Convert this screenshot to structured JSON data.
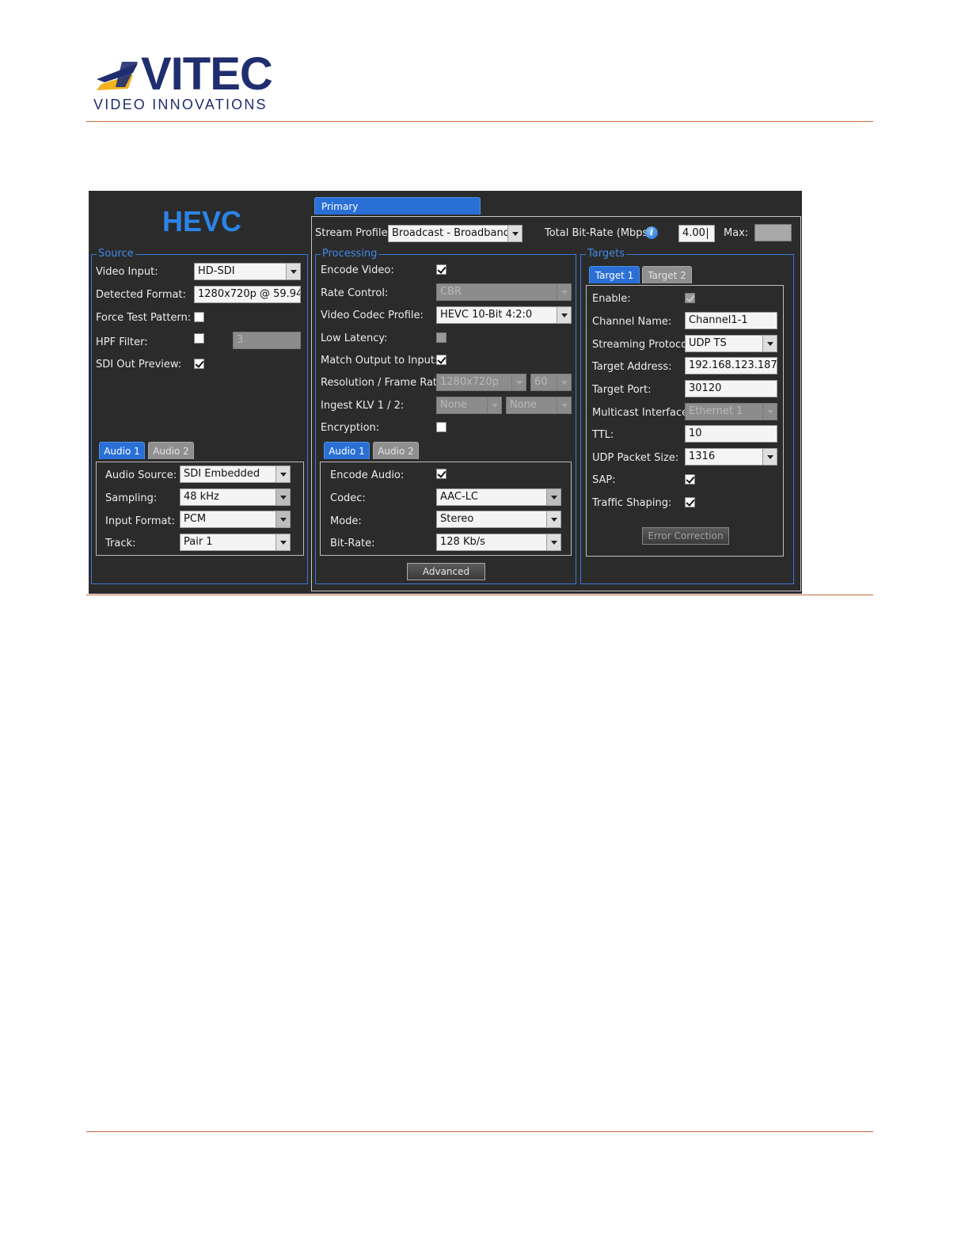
{
  "logo": {
    "brand": "VITEC",
    "tagline": "VIDEO INNOVATIONS",
    "colors": {
      "navy": "#1f2e6e",
      "yellow": "#f0b31e"
    }
  },
  "app": {
    "title_logo": "HEVC",
    "main_tab": "Primary",
    "header": {
      "stream_profile_label": "Stream Profile:",
      "stream_profile_value": "Broadcast - Broadband",
      "total_bitrate_label": "Total Bit-Rate (Mbps)",
      "total_bitrate_value": "4.00",
      "max_label": "Max:",
      "max_value": ""
    },
    "source": {
      "legend": "Source",
      "video_input_label": "Video Input:",
      "video_input_value": "HD-SDI",
      "detected_format_label": "Detected Format:",
      "detected_format_value": "1280x720p @ 59.94",
      "force_test_pattern_label": "Force Test Pattern:",
      "hpf_filter_label": "HPF Filter:",
      "hpf_value": "3",
      "sdi_out_preview_label": "SDI Out Preview:",
      "audio_tabs": [
        "Audio 1",
        "Audio 2"
      ],
      "audio": {
        "source_label": "Audio Source:",
        "source_value": "SDI Embedded",
        "sampling_label": "Sampling:",
        "sampling_value": "48 kHz",
        "input_format_label": "Input Format:",
        "input_format_value": "PCM",
        "track_label": "Track:",
        "track_value": "Pair 1"
      }
    },
    "processing": {
      "legend": "Processing",
      "encode_video_label": "Encode Video:",
      "rate_control_label": "Rate Control:",
      "rate_control_value": "CBR",
      "codec_profile_label": "Video Codec Profile:",
      "codec_profile_value": "HEVC 10-Bit 4:2:0",
      "low_latency_label": "Low Latency:",
      "match_output_label": "Match Output to Input:",
      "resolution_label": "Resolution / Frame Rate:",
      "resolution_value": "1280x720p",
      "frame_rate_value": "60",
      "klv_label": "Ingest KLV 1 / 2:",
      "klv1_value": "None",
      "klv2_value": "None",
      "encryption_label": "Encryption:",
      "audio_tabs": [
        "Audio 1",
        "Audio 2"
      ],
      "audio": {
        "encode_audio_label": "Encode Audio:",
        "codec_label": "Codec:",
        "codec_value": "AAC-LC",
        "mode_label": "Mode:",
        "mode_value": "Stereo",
        "bitrate_label": "Bit-Rate:",
        "bitrate_value": "128 Kb/s"
      },
      "advanced_button": "Advanced"
    },
    "targets": {
      "legend": "Targets",
      "tabs": [
        "Target 1",
        "Target 2"
      ],
      "enable_label": "Enable:",
      "channel_name_label": "Channel Name:",
      "channel_name_value": "Channel1-1",
      "protocol_label": "Streaming Protocol:",
      "protocol_value": "UDP TS",
      "address_label": "Target Address:",
      "address_value": "192.168.123.187",
      "port_label": "Target Port:",
      "port_value": "30120",
      "multicast_label": "Multicast Interface:",
      "multicast_value": "Ethernet 1",
      "ttl_label": "TTL:",
      "ttl_value": "10",
      "packet_size_label": "UDP Packet Size:",
      "packet_size_value": "1316",
      "sap_label": "SAP:",
      "traffic_shaping_label": "Traffic Shaping:",
      "error_correction_button": "Error Correction"
    },
    "checkbox_states": {
      "force_test_pattern": false,
      "hpf_filter": false,
      "sdi_out_preview": true,
      "encode_video": true,
      "low_latency": false,
      "match_output": true,
      "encryption": false,
      "encode_audio": true,
      "enable": true,
      "sap": true,
      "traffic_shaping": true
    },
    "colors": {
      "panel_bg": "#2b2b2b",
      "accent_blue": "#3c78d8",
      "tab_active": "#2a6fd6"
    }
  }
}
